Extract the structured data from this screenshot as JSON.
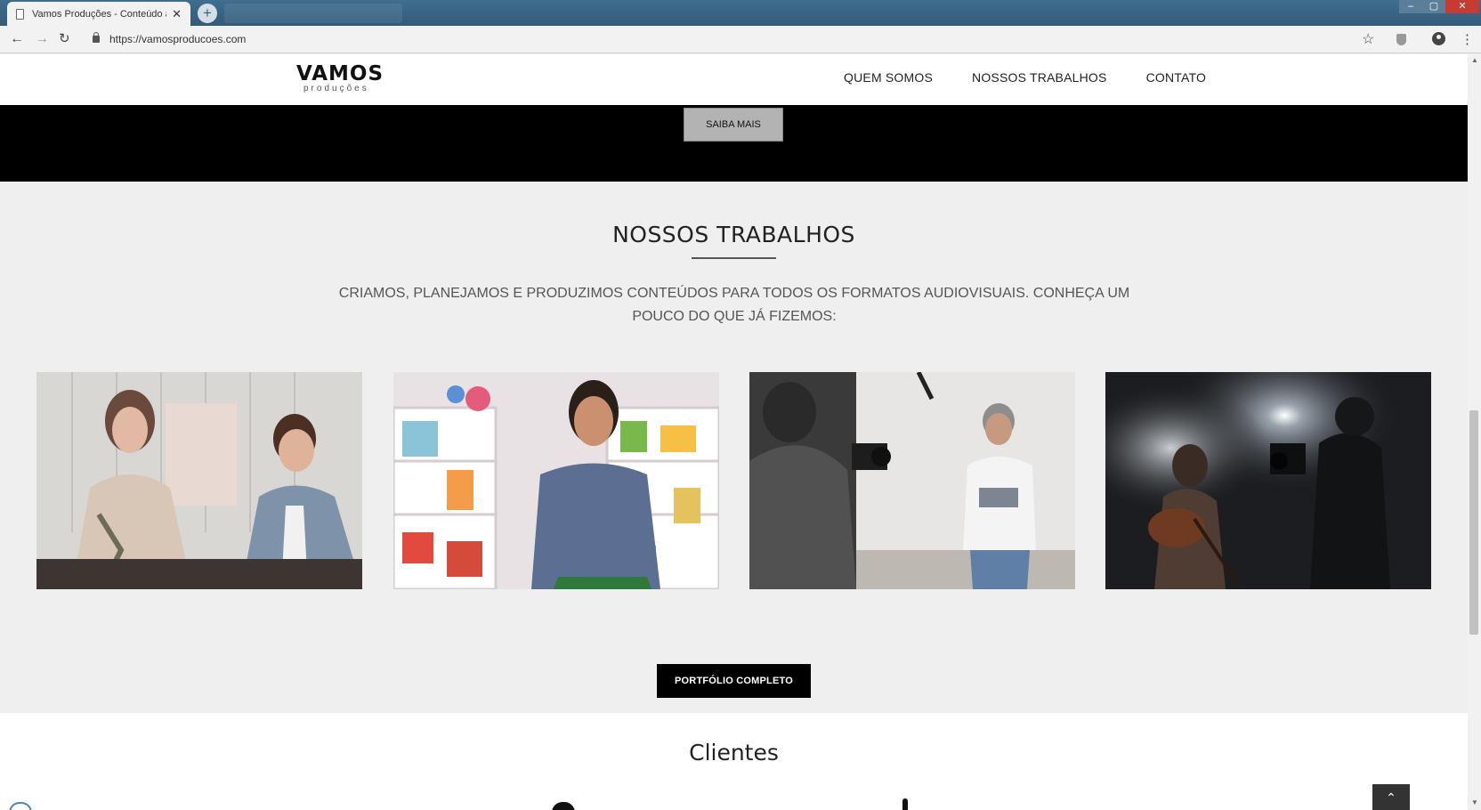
{
  "browser": {
    "tab_title": "Vamos Produções - Conteúdo a",
    "tab_close": "✕",
    "new_tab": "+",
    "url": "https://vamosproducoes.com",
    "back_glyph": "←",
    "forward_glyph": "→",
    "reload_glyph": "↻",
    "star_glyph": "☆",
    "menu_glyph": "⋮",
    "min_glyph": "–",
    "max_glyph": "▢",
    "close_glyph": "✕"
  },
  "header": {
    "logo_text": "VAMOS",
    "logo_sub": "produções",
    "nav": [
      {
        "label": "QUEM SOMOS"
      },
      {
        "label": "NOSSOS TRABALHOS"
      },
      {
        "label": "CONTATO"
      }
    ]
  },
  "hero": {
    "cta_label": "SAIBA MAIS"
  },
  "works": {
    "title": "NOSSOS TRABALHOS",
    "description": "CRIAMOS, PLANEJAMOS E PRODUZIMOS CONTEÚDOS PARA TODOS OS FORMATOS AUDIOVISUAIS. CONHEÇA UM POUCO DO QUE JÁ FIZEMOS:",
    "portfolio_label": "PORTFÓLIO COMPLETO"
  },
  "clients": {
    "title": "Clientes",
    "back_to_top_glyph": "⌃"
  },
  "icons": [
    "document-icon",
    "lock-icon",
    "star-icon",
    "extension-icon",
    "account-icon",
    "menu-icon"
  ]
}
